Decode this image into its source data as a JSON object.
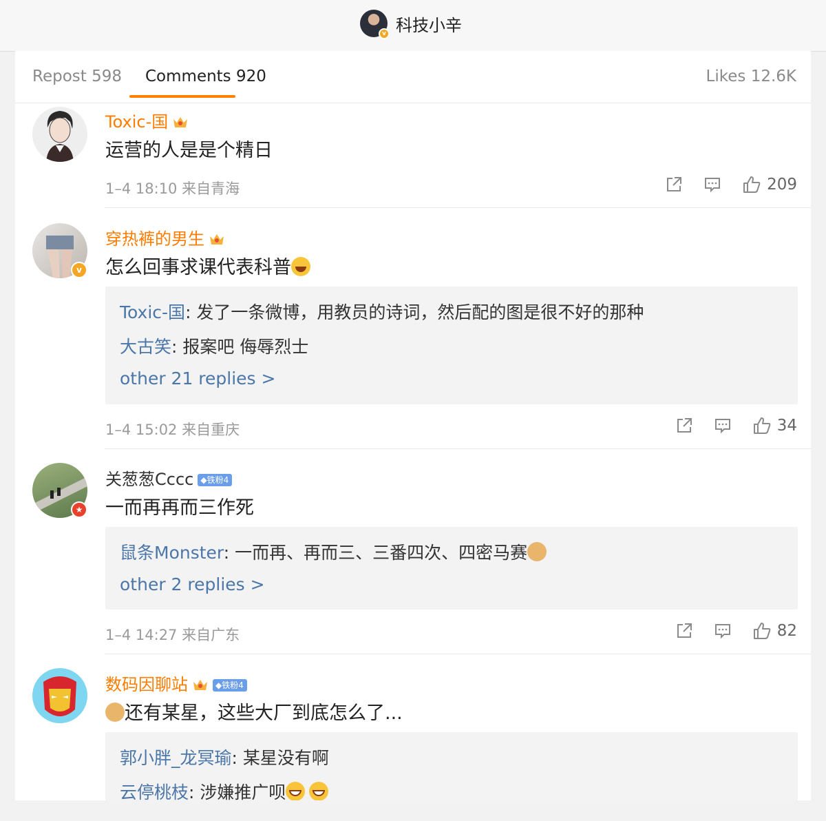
{
  "header": {
    "author_name": "科技小辛",
    "verified_badge": "v"
  },
  "tabs": {
    "repost": "Repost 598",
    "comments": "Comments 920",
    "likes": "Likes 12.6K"
  },
  "colors": {
    "accent": "#ff8200",
    "link": "#4b76a8",
    "username_orange": "#ff7c00"
  },
  "comments": [
    {
      "username": "Toxic-国",
      "has_crown": true,
      "text": "运营的人是是个精日",
      "time": "1–4 18:10",
      "location": "来自青海",
      "likes": "209"
    },
    {
      "username": "穿热裤的男生",
      "has_crown": true,
      "avatar_badge": "v",
      "text": "怎么回事求课代表科普",
      "text_emoji": "laugh-cry-emoji",
      "replies": [
        {
          "user": "Toxic-国",
          "text": ": 发了一条微博，用教员的诗词，然后配的图是很不好的那种"
        },
        {
          "user": "大古笑",
          "text": ": 报案吧 侮辱烈士"
        }
      ],
      "more": "other 21 replies >",
      "time": "1–4 15:02",
      "location": "来自重庆",
      "likes": "34"
    },
    {
      "username": "关葱葱Cccc",
      "fan_badge": "铁粉4",
      "avatar_badge": "★",
      "text": "一而再再而三作死",
      "replies": [
        {
          "user": "鼠条Monster",
          "text": ": 一而再、再而三、三番四次、四密马赛"
        }
      ],
      "more": "other 2 replies >",
      "time": "1–4 14:27",
      "location": "来自广东",
      "likes": "82"
    },
    {
      "username": "数码因聊站",
      "has_crown": true,
      "fan_badge": "铁粉4",
      "text": "还有某星，这些大厂到底怎么了...",
      "replies": [
        {
          "user": "郭小胖_龙冥瑜",
          "text": ": 某星没有啊"
        },
        {
          "user": "云停桃枝",
          "text": ": 涉嫌推广呗"
        }
      ]
    }
  ]
}
